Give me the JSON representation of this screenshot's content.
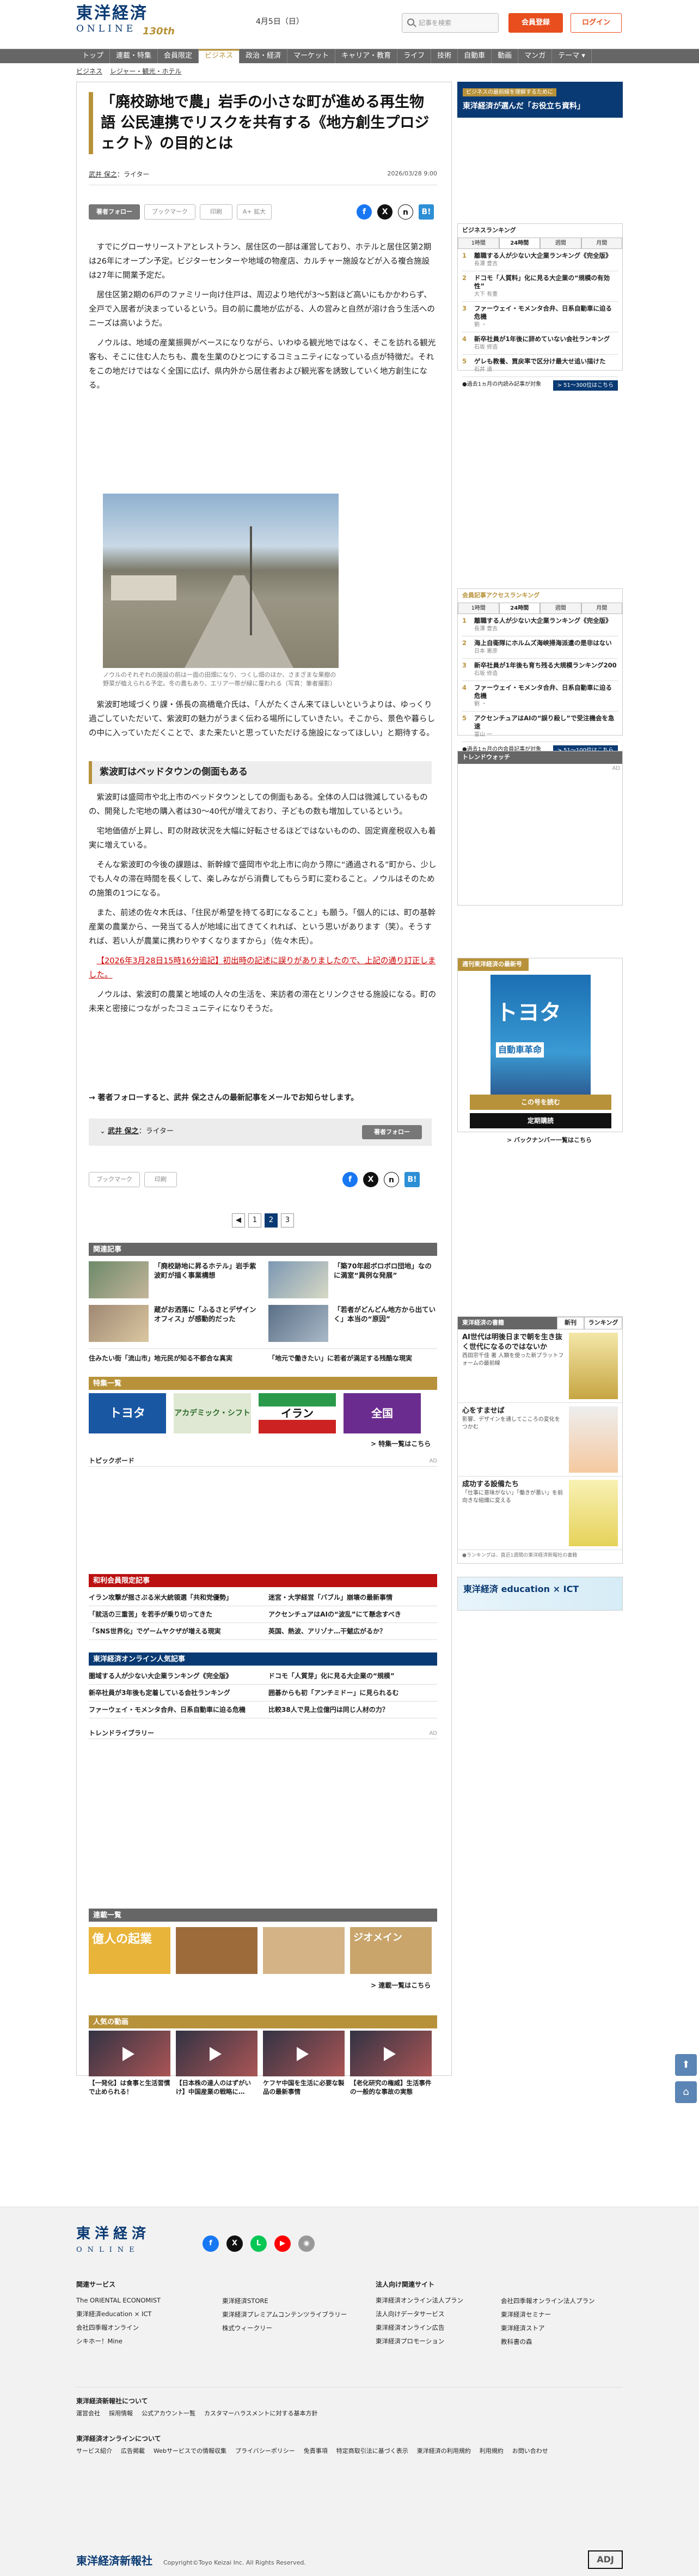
{
  "header": {
    "logo_jp": "東洋経済",
    "logo_en": "ONLINE",
    "logo_years": "130th",
    "date": "4月5日（日）",
    "search_placeholder": "記事を検索",
    "member_button": "会員登録",
    "login_button": "ログイン"
  },
  "nav": [
    "トップ",
    "連載・特集",
    "会員限定",
    "ビジネス",
    "政治・経済",
    "マーケット",
    "キャリア・教育",
    "ライフ",
    "技術",
    "自動車",
    "動画",
    "マンガ",
    "テーマ ▾"
  ],
  "nav_active": "ビジネス",
  "breadcrumb": [
    "ビジネス",
    "レジャー・観光・ホテル"
  ],
  "article": {
    "title": "「廃校跡地で農」岩手の小さな町が進める再生物語 公民連携でリスクを共有する《地方創生プロジェクト》の目的とは",
    "author_name": "武井 保之",
    "author_role": "：ライター",
    "published": "2026/03/28 9:00",
    "tools": {
      "follow": "著者フォロー",
      "bookmark": "ブックマーク",
      "print": "印刷",
      "font": "A+ 拡大"
    },
    "paragraphs_1": [
      "すでにグローサリーストアとレストラン、居住区の一部は運営しており、ホテルと居住区第2期は26年にオープン予定。ビジターセンターや地域の物産店、カルチャー施設などが入る複合施設は27年に開業予定だ。",
      "居住区第2期の6戸のファミリー向け住戸は、周辺より地代が3〜5割ほど高いにもかかわらず、全戸で入居者が決まっているという。目の前に農地が広がる、人の営みと自然が溶け合う生活へのニーズは高いようだ。",
      "ノウルは、地域の産業振興がベースになりながら、いわゆる観光地ではなく、そこを訪れる観光客も、そこに住む人たちも、農を生業のひとつにするコミュニティになっている点が特徴だ。それをこの地だけではなく全国に広げ、県内外から居住者および観光客を誘致していく地方創生になる。"
    ],
    "photo_caption": "ノウルのそれぞれの施設の前は一面の田畑になり、つくし畑のほか、さまざまな果樹の野菜が植えられる予定。冬の農もあり、エリア一帯が緑に覆われる（写真：筆者撮影）",
    "paragraphs_2": [
      "紫波町地域づくり課・係長の高橋竜介氏は、「人がたくさん来てほしいというよりは、ゆっくり過ごしていただいて、紫波町の魅力がうまく伝わる場所にしていきたい。そこから、景色や暮らしの中に入っていただくことで、また来たいと思っていただける施設になってほしい」と期待する。"
    ],
    "h2": "紫波町はベッドタウンの側面もある",
    "paragraphs_3": [
      "紫波町は盛岡市や北上市のベッドタウンとしての側面もある。全体の人口は微減しているものの、開発した宅地の購入者は30〜40代が増えており、子どもの数も増加しているという。",
      "宅地価値が上昇し、町の財政状況を大幅に好転させるほどではないものの、固定資産税収入も着実に増えている。",
      "そんな紫波町の今後の課題は、新幹線で盛岡市や北上市に向かう際に“通過される”町から、少しでも人々の滞在時間を長くして、楽しみながら消費してもらう町に変わること。ノウルはそのための施策の1つになる。",
      "また、前述の佐々木氏は、「住民が希望を持てる町になること」も願う。「個人的には、町の基幹産業の農業から、一発当てる人が地域に出てきてくれれば、という思いがあります（笑）。そうすれば、若い人が農業に携わりやすくなりますから」（佐々木氏）。"
    ],
    "correction": "【2026年3月28日15時16分追記】初出時の記述に誤りがありましたので、上記の通り訂正しました。",
    "paragraphs_4": [
      "ノウルは、紫波町の農業と地域の人々の生活を、来訪者の滞在とリンクさせる施設になる。町の未来と密接につながったコミュニティになりそうだ。"
    ],
    "follow_cta": "→ 著者フォローすると、武井 保之さんの最新記事をメールでお知らせします。",
    "author_box_name": "武井 保之",
    "author_box_role": "：ライター",
    "author_box_follow": "著者フォロー",
    "pager": [
      "1",
      "2",
      "3"
    ]
  },
  "related": {
    "header": "関連記事",
    "items": [
      "「廃校跡地に昇るホテル」岩手紫波町が描く事業構想",
      "「築70年超ボロボロ団地」なのに満室“異例な発展”",
      "蔵がお洒落に「ふるさとデザインオフィス」が感動的だった",
      "「若者がどんどん地方から出ていく」本当の“原因”"
    ],
    "small": [
      "住みたい街「流山市」地元民が知る不都合な真実",
      "「地元で働きたい」に若者が満足する残酷な現実"
    ]
  },
  "tokushu": {
    "header": "特集一覧",
    "more": "> 特集一覧はこちら",
    "items": [
      "トヨタ",
      "アカデミック・シフト",
      "イラン",
      "全国"
    ]
  },
  "topics": {
    "header": "トピックボード",
    "ad": "AD"
  },
  "popular": {
    "header": "和利会員限定記事",
    "rows": [
      [
        "イラン攻撃が揺さぶる米大統領選「共和党優勢」",
        "迷宮・大学経営「バブル」崩壊の最新事情"
      ],
      [
        "「就活の三重苦」を若手が乗り切ってきた",
        "アクセンチュアはAIの“波乱”にて懸念すべき"
      ],
      [
        "「SNS世界化」でゲームヤクザが増える現実",
        "英国、熱波、アリゾナ…干魃広がるか？"
      ]
    ]
  },
  "popular2": {
    "header": "東洋経済オンライン人気記事",
    "rows": [
      [
        "圏域する人が少ない大企業ランキング《完全版》",
        "ドコモ「人質芽」化に見る大企業の“規模”"
      ],
      [
        "新卒社員が3年後も定着している会社ランキング",
        "囲碁からも初「アンチミドー」に見られるむ"
      ],
      [
        "ファーウェイ・モメンタ合弁、日系自動車に迫る危機",
        "比較38人で見上位億円は同じ人材の力？"
      ]
    ]
  },
  "trend": {
    "header": "トレンドライブラリー",
    "ad": "AD"
  },
  "series": {
    "header": "連載一覧",
    "more": "> 連載一覧はこちら",
    "items": [
      "億人の起業",
      "",
      "",
      "ジオメイン"
    ]
  },
  "video": {
    "header": "人気の動画",
    "items": [
      "【一発化】は食事と生活習慣で止められる！",
      "【日本株の達人のはずがいけ】中国産業の戦略に…",
      "ケフヤ中国を生活に必要な製品の最新事情",
      "【老化研究の権威】生活事件の一般的な事故の実態"
    ]
  },
  "sidebar": {
    "banner_small": "ビジネスの最前線を理解するために",
    "banner_main": "東洋経済が選んだ「お役立ち資料」",
    "ranking": {
      "title": "ビジネスランキング",
      "tabs": [
        "1時間",
        "24時間",
        "週間",
        "月間"
      ],
      "items": [
        {
          "t": "離職する人が少ない大企業ランキング《完全版》",
          "a": "長澤 豊吉"
        },
        {
          "t": "ドコモ「人質料」化に見る大企業の“規模の有効性”",
          "a": "大下 有重"
        },
        {
          "t": "ファーウェイ・モメンタ合弁、日系自動車に迫る危機",
          "a": "劉 ・"
        },
        {
          "t": "新卒社員が1年後に辞めていない会社ランキング",
          "a": "石坂 修造"
        },
        {
          "t": "ゲレも教養、買戻率で区分け最大せ追い描けた",
          "a": "石井 道"
        }
      ],
      "foot_note": "●過去1ヵ月の内読み記事が対象",
      "foot_btn": "> 51〜300位はこちら"
    },
    "ranking2": {
      "title": "会員記事アクセスランキング",
      "tabs": [
        "1時間",
        "24時間",
        "週間",
        "月間"
      ],
      "items": [
        {
          "t": "離職する人が少ない大企業ランキング《完全版》",
          "a": "長澤 豊吉"
        },
        {
          "t": "海上自衛隊にホルムズ海峡掃海派遣の是非はない",
          "a": "日本 憲彦"
        },
        {
          "t": "新卒社員が1年後も育ち残る大規模ランキング200",
          "a": "石坂 修造"
        },
        {
          "t": "ファーウェイ・モメンタ合弁、日系自動車に迫る危機",
          "a": "劉 ・"
        },
        {
          "t": "アクセンチュアはAIの“誤り殺し”で受注機会を急速",
          "a": "富山 一"
        }
      ],
      "foot_note": "●過去1ヵ月の内会員記事が対象",
      "foot_btn": "> 51〜100位はこちら"
    },
    "trend": {
      "header": "トレンドウォッチ",
      "ad": "AD"
    },
    "magazine": {
      "header": "週刊東洋経済の最新号",
      "cover": "トヨタ",
      "cover_sub": "自動車革命",
      "buy": "この号を読む",
      "sub": "定期購読",
      "back": "> バックナンバー一覧はこちら"
    },
    "books": {
      "header": "東洋経済の書籍",
      "tabs": [
        "新刊",
        "ランキング"
      ],
      "items": [
        {
          "t": "AI世代は明後日まで朝を生き抜く世代になるのではないか",
          "s": "西田宗千佳 著 人類を使った新プラットフォームの最前線"
        },
        {
          "t": "心をすませば",
          "s": "影響、デザインを通してこころの変化をつかむ"
        },
        {
          "t": "成功する設備たち",
          "s": "「仕事に意味がない」「働きが悪い」を前向きな組織に変える"
        }
      ],
      "note": "●ランキングは、直近1週間の東洋経済新報社の書籍"
    },
    "edu": "東洋経済 education × ICT"
  },
  "footer": {
    "logo_jp": "東洋経済",
    "logo_en": "ONLINE",
    "col1_h": "関連サービス",
    "col1": [
      "The ORIENTAL ECONOMIST",
      "東洋経済education × ICT",
      "会社四季報オンライン",
      "シキホー！Mine"
    ],
    "col2": [
      "東洋経済STORE",
      "東洋経済プレミアムコンテンツライブラリー",
      "株式ウィークリー"
    ],
    "col3_h": "法人向け関連サイト",
    "col3": [
      "東洋経済オンライン法人プラン",
      "法人向けデータサービス",
      "東洋経済オンライン広告",
      "東洋経済プロモーション"
    ],
    "col4": [
      "会社四季報オンライン法人プラン",
      "東洋経済セミナー",
      "東洋経済ストア",
      "教科書の森"
    ],
    "about_h": "東洋経済新報社について",
    "about": [
      "運営会社",
      "採用情報",
      "公式アカウント一覧",
      "カスタマーハラスメントに対する基本方針"
    ],
    "terms_h": "東洋経済オンラインについて",
    "terms": [
      "サービス紹介",
      "広告掲載",
      "Webサービスでの情報収集",
      "プライバシーポリシー",
      "免責事項",
      "特定商取引法に基づく表示",
      "東洋経済の利用規約",
      "利用規約",
      "お問い合わせ"
    ],
    "company": "東洋経済新報社",
    "copyright": "Copyright©Toyo Keizai Inc. All Rights Reserved.",
    "adj": "ADJ"
  },
  "colors": {
    "brand": "#0a3a73",
    "accent": "#b8923a",
    "member": "#e84e1e"
  }
}
